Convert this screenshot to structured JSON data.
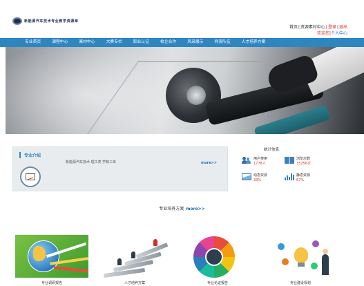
{
  "header": {
    "logo_text": "新能源汽车技术专业教学资源库",
    "links_row1": {
      "home": "首页",
      "sep1": "|",
      "resource": "资源素材中心",
      "sep2": "|",
      "login": "登录",
      "sep3": "|",
      "logout": "退出"
    },
    "links_row2": {
      "welcome": "欢迎您",
      "sep": "|",
      "personal": "个人中心"
    }
  },
  "nav": {
    "items": [
      "专业首页",
      "课程中心",
      "素材中心",
      "大赛专栏",
      "职业认证",
      "校企合作",
      "风采展示",
      "师资队伍",
      "人才培养方案"
    ]
  },
  "intro": {
    "title": "专业介绍",
    "text": "新能源汽车技术  理工类  学制三年",
    "more": "more>>"
  },
  "stats": {
    "title": "统计信息",
    "items": [
      {
        "label": "用户使用",
        "value": "1778人",
        "icon": "users-icon"
      },
      {
        "label": "浏览次数",
        "value": "33256次",
        "icon": "book-icon"
      },
      {
        "label": "动态资源",
        "value": "33%",
        "icon": "wave-chart-icon"
      },
      {
        "label": "静态资源",
        "value": "67%",
        "icon": "bar-chart-icon"
      }
    ]
  },
  "plan": {
    "heading": "专业培养方案",
    "more": "more>>",
    "cards": [
      {
        "caption": "专业调研报告"
      },
      {
        "caption": "人才培养方案"
      },
      {
        "caption": "专业论证报告"
      },
      {
        "caption": "专业建设规划"
      }
    ]
  }
}
